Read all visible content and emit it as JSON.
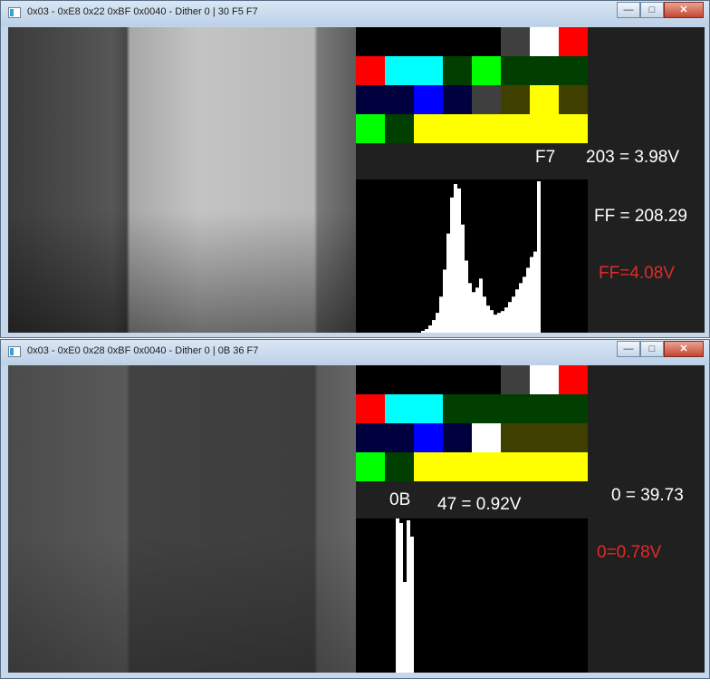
{
  "windows": [
    {
      "title": "0x03 - 0xE8 0x22 0xBF 0x0040 - Dither 0 | 30 F5 F7",
      "caption": {
        "minimize": "—",
        "maximize": "□",
        "close": "✕"
      },
      "hex_label": "F7",
      "voltage_label": "203 = 3.98V",
      "mean_label": "FF = 208.29",
      "alert_label": "FF=4.08V",
      "alert_color": "#e02a2a",
      "palette": [
        [
          "#000000",
          "#000000",
          "#000000",
          "#000000",
          "#000000",
          "#404040",
          "#ffffff",
          "#ff0000"
        ],
        [
          "#ff0000",
          "#00ffff",
          "#00ffff",
          "#003f00",
          "#00ff00",
          "#003f00",
          "#003f00",
          "#003f00"
        ],
        [
          "#00003f",
          "#00003f",
          "#0000ff",
          "#00003f",
          "#404040",
          "#3f3f00",
          "#ffff00",
          "#3f3f00"
        ],
        [
          "#00ff00",
          "#003f00",
          "#ffff00",
          "#ffff00",
          "#ffff00",
          "#ffff00",
          "#ffff00",
          "#ffff00"
        ]
      ],
      "histogram": {
        "bins": 64,
        "counts": [
          0,
          0,
          0,
          0,
          0,
          0,
          0,
          0,
          0,
          0,
          0,
          0,
          0,
          0,
          0,
          0,
          0,
          0,
          2,
          4,
          8,
          14,
          22,
          40,
          70,
          110,
          150,
          165,
          160,
          120,
          80,
          55,
          45,
          50,
          60,
          40,
          30,
          25,
          20,
          22,
          24,
          28,
          34,
          40,
          48,
          55,
          62,
          72,
          84,
          90,
          168,
          0,
          0,
          0,
          0,
          0,
          0,
          0,
          0,
          0,
          0,
          0,
          0,
          0
        ],
        "max": 170,
        "color": "#ffffff"
      }
    },
    {
      "title": "0x03 - 0xE0 0x28 0xBF 0x0040 - Dither 0 | 0B 36 F7",
      "caption": {
        "minimize": "—",
        "maximize": "□",
        "close": "✕"
      },
      "hex_label": "0B",
      "voltage_label": "47 = 0.92V",
      "mean_label": "0 = 39.73",
      "alert_label": "0=0.78V",
      "alert_color": "#e02a2a",
      "palette": [
        [
          "#000000",
          "#000000",
          "#000000",
          "#000000",
          "#000000",
          "#404040",
          "#ffffff",
          "#ff0000"
        ],
        [
          "#ff0000",
          "#00ffff",
          "#00ffff",
          "#003f00",
          "#003f00",
          "#003f00",
          "#003f00",
          "#003f00"
        ],
        [
          "#00003f",
          "#00003f",
          "#0000ff",
          "#00003f",
          "#ffffff",
          "#3f3f00",
          "#3f3f00",
          "#3f3f00"
        ],
        [
          "#00ff00",
          "#003f00",
          "#ffff00",
          "#ffff00",
          "#ffff00",
          "#ffff00",
          "#ffff00",
          "#ffff00"
        ]
      ],
      "histogram": {
        "bins": 64,
        "counts": [
          0,
          0,
          0,
          0,
          0,
          0,
          0,
          0,
          0,
          0,
          0,
          170,
          165,
          100,
          168,
          150,
          0,
          0,
          0,
          0,
          0,
          0,
          0,
          0,
          0,
          0,
          0,
          0,
          0,
          0,
          0,
          0,
          0,
          0,
          0,
          0,
          0,
          0,
          0,
          0,
          0,
          0,
          0,
          0,
          0,
          0,
          0,
          0,
          0,
          0,
          0,
          0,
          0,
          0,
          0,
          0,
          0,
          0,
          0,
          0,
          0,
          0,
          0,
          0
        ],
        "max": 170,
        "color": "#ffffff"
      }
    }
  ]
}
